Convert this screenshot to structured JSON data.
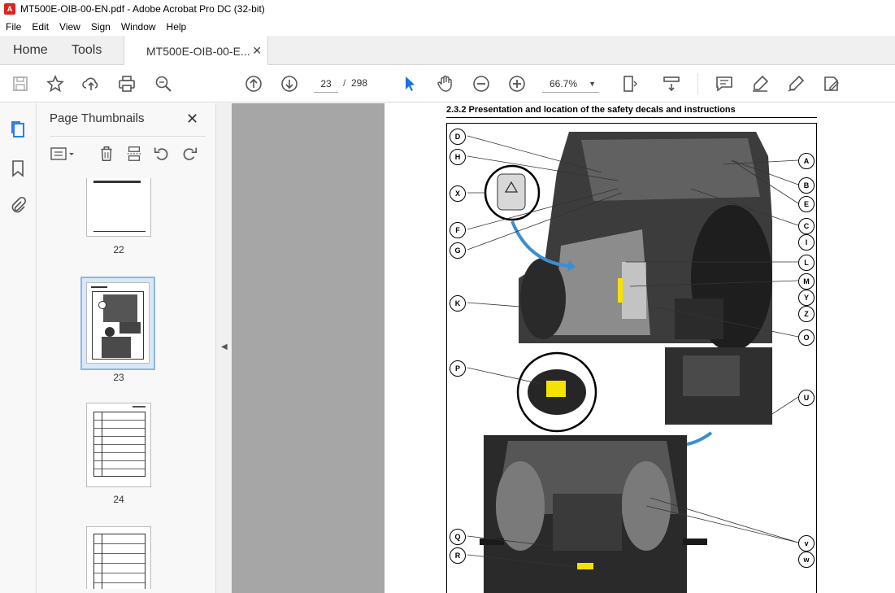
{
  "window": {
    "title": "MT500E-OIB-00-EN.pdf - Adobe Acrobat Pro DC (32-bit)",
    "app_icon": "acrobat-pdf-icon"
  },
  "menu": [
    "File",
    "Edit",
    "View",
    "Sign",
    "Window",
    "Help"
  ],
  "tabs": {
    "home": "Home",
    "tools": "Tools",
    "document": "MT500E-OIB-00-E...",
    "close_glyph": "✕"
  },
  "toolbar": {
    "current_page": "23",
    "separator": "/",
    "total_pages": "298",
    "zoom": "66.7%",
    "icons": [
      "save-icon",
      "bookmark-star-icon",
      "upload-icon",
      "print-icon",
      "search-zoom-icon",
      "prev-page-icon",
      "next-page-icon",
      "select-cursor-icon",
      "hand-icon",
      "zoom-out-icon",
      "zoom-in-icon",
      "page-fit-icon",
      "scroll-mode-icon",
      "comment-icon",
      "highlight-icon",
      "fill-sign-icon",
      "edit-pdf-icon"
    ]
  },
  "left_rail": [
    "page-thumbnails-icon",
    "bookmarks-icon",
    "attachments-icon"
  ],
  "thumbnail_panel": {
    "title": "Page Thumbnails",
    "close_glyph": "✕",
    "thumbnails": [
      {
        "label": "22"
      },
      {
        "label": "23"
      },
      {
        "label": "24"
      },
      {
        "label": ""
      }
    ]
  },
  "document": {
    "section_heading": "2.3.2  Presentation and location of the safety decals and instructions",
    "callouts_left": [
      "D",
      "H",
      "X",
      "F",
      "G",
      "K",
      "P",
      "Q",
      "R"
    ],
    "callouts_right": [
      "A",
      "B",
      "E",
      "C",
      "I",
      "L",
      "M",
      "Y",
      "Z",
      "O",
      "U",
      "v",
      "w"
    ]
  },
  "colors": {
    "accent_blue": "#1473e6",
    "doc_background": "#a6a6a6",
    "selection_border": "#8fb6e0"
  }
}
